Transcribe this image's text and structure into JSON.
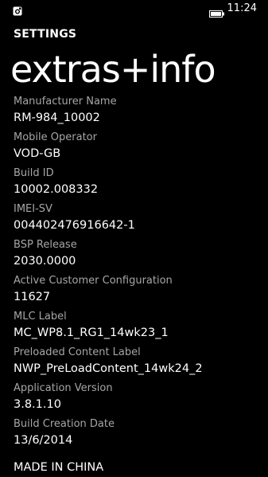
{
  "status_bar": {
    "left_icon": "notification-icon",
    "battery_icon": "battery-icon",
    "time": "11:24"
  },
  "header": {
    "app_title": "SETTINGS",
    "page_title": "extras+info"
  },
  "info": [
    {
      "label": "Manufacturer Name",
      "value": "RM-984_10002"
    },
    {
      "label": "Mobile Operator",
      "value": "VOD-GB"
    },
    {
      "label": "Build ID",
      "value": "10002.008332"
    },
    {
      "label": "IMEI-SV",
      "value": "004402476916642-1"
    },
    {
      "label": "BSP Release",
      "value": "2030.0000"
    },
    {
      "label": "Active Customer Configuration",
      "value": "11627"
    },
    {
      "label": "MLC Label",
      "value": "MC_WP8.1_RG1_14wk23_1"
    },
    {
      "label": "Preloaded Content Label",
      "value": "NWP_PreLoadContent_14wk24_2"
    },
    {
      "label": "Application Version",
      "value": "3.8.1.10"
    },
    {
      "label": "Build Creation Date",
      "value": "13/6/2014"
    }
  ],
  "footer": {
    "made_in": "MADE IN CHINA"
  },
  "colors": {
    "background": "#000000",
    "label": "#a6a6a6",
    "value": "#ffffff"
  }
}
